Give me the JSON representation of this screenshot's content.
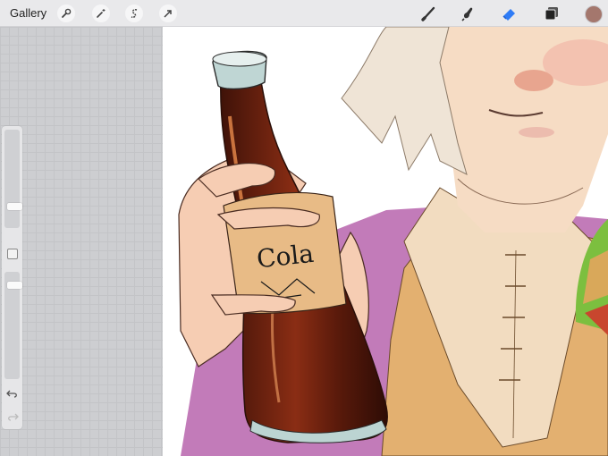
{
  "toolbar": {
    "gallery_label": "Gallery",
    "left_tools": [
      "wrench-icon",
      "magic-wand-icon",
      "selection-icon",
      "transform-arrow-icon"
    ],
    "right_tools": [
      "brush-icon",
      "smudge-icon",
      "eraser-icon",
      "layers-icon"
    ],
    "active_tool": "eraser",
    "active_color": "#a4776d",
    "accent": "#2f7cf6"
  },
  "sidebar": {
    "brush_size_level": 0.2,
    "opacity_level": 0.1
  },
  "artwork": {
    "bottle_label": "Cola"
  }
}
